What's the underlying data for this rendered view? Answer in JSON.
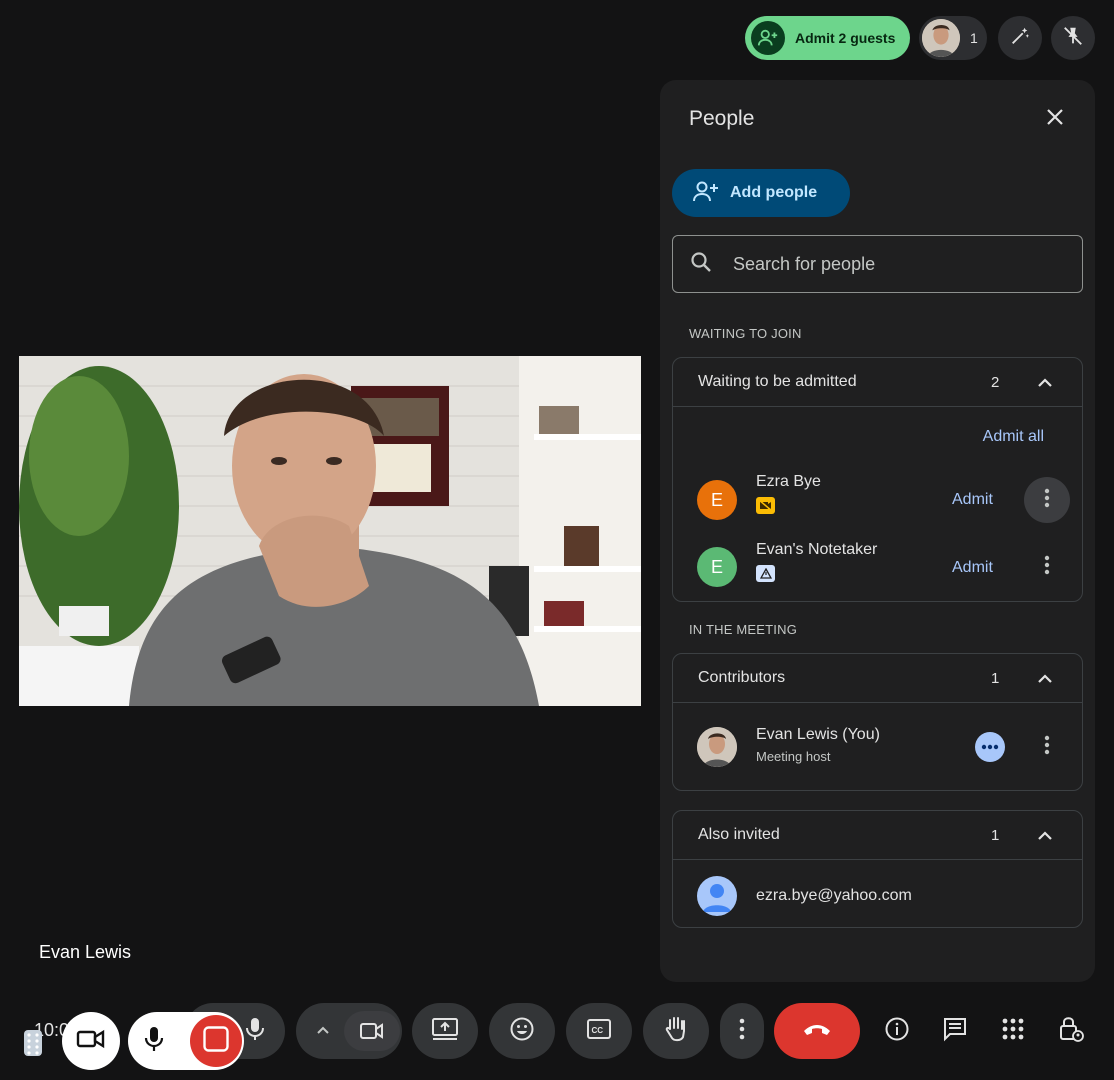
{
  "top_bar": {
    "admit_label": "Admit 2 guests",
    "participant_count": "1",
    "icons": [
      "person-add-icon",
      "edit-sparkle-icon",
      "pin-off-icon"
    ]
  },
  "video": {
    "self_name": "Evan Lewis",
    "clock_fragment": "10:0"
  },
  "panel": {
    "title": "People",
    "add_people_label": "Add people",
    "search_placeholder": "Search for people",
    "waiting_section_label": "WAITING TO JOIN",
    "waiting_card": {
      "title": "Waiting to be admitted",
      "count": "2",
      "admit_all_label": "Admit all",
      "guests": [
        {
          "initial": "E",
          "name": "Ezra Bye",
          "admit_label": "Admit",
          "avatar_color": "#e8710a",
          "badge_color": "#fbbc04"
        },
        {
          "initial": "E",
          "name": "Evan's Notetaker",
          "admit_label": "Admit",
          "avatar_color": "#5bb974",
          "badge_color": "#d3e3fd"
        }
      ]
    },
    "meeting_section_label": "IN THE MEETING",
    "contributors_card": {
      "title": "Contributors",
      "count": "1",
      "members": [
        {
          "name": "Evan Lewis (You)",
          "role": "Meeting host"
        }
      ]
    },
    "invited_card": {
      "title": "Also invited",
      "count": "1",
      "invitees": [
        {
          "email": "ezra.bye@yahoo.com"
        }
      ]
    }
  },
  "colors": {
    "background": "#131314",
    "panel": "#1f1f20",
    "accent_link": "#a8c7fa",
    "admit_green": "#6dd58c",
    "end_call_red": "#dc362e",
    "add_people_bg": "#004a77"
  },
  "bottom_bar": {
    "icons": [
      "microphone-icon",
      "chevron-up-icon",
      "camera-icon",
      "present-screen-icon",
      "emoji-icon",
      "captions-icon",
      "raise-hand-icon",
      "more-options-icon",
      "end-call-icon",
      "info-icon",
      "chat-icon",
      "activities-icon",
      "host-controls-icon"
    ]
  }
}
